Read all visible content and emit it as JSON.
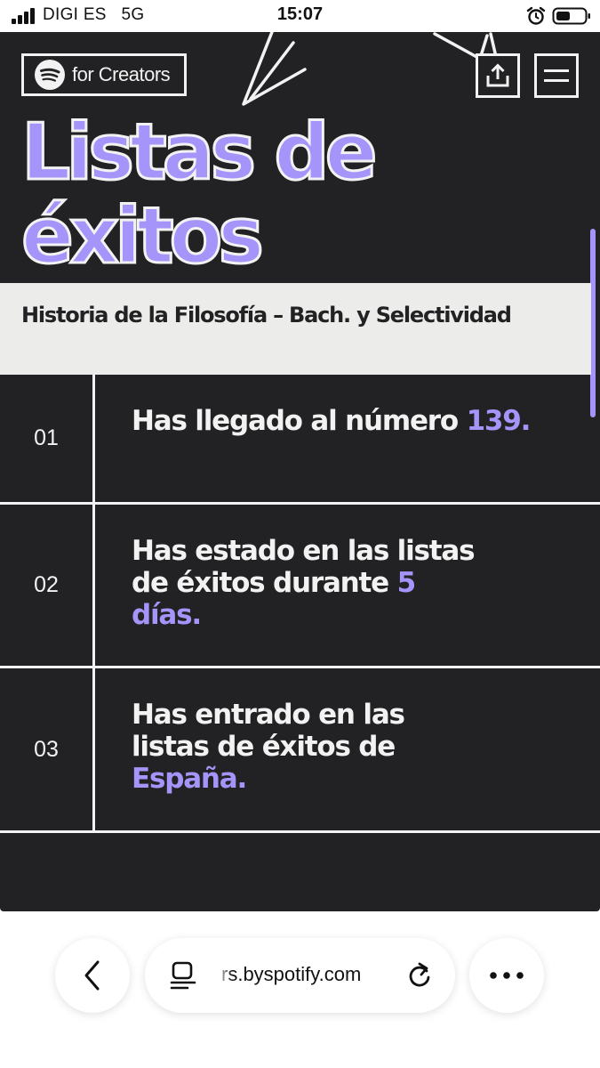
{
  "status_bar": {
    "carrier": "DIGI ES",
    "network": "5G",
    "time": "15:07"
  },
  "header": {
    "logo_text": "for Creators",
    "share_icon": "share-upload-icon",
    "menu_icon": "hamburger-menu-icon"
  },
  "hero": {
    "title": "Listas de éxitos"
  },
  "podcast": {
    "name": "Historia de la Filosofía – Bach. y Selectividad"
  },
  "stats": [
    {
      "number": "01",
      "text": "Has llegado al número ",
      "highlight": "139."
    },
    {
      "number": "02",
      "text": "Has estado en las listas de éxitos durante ",
      "highlight": "5 días."
    },
    {
      "number": "03",
      "text": "Has entrado en las listas de éxitos de ",
      "highlight": "España."
    }
  ],
  "browser": {
    "url": "rs.byspotify.com",
    "back_icon": "chevron-left-icon",
    "page_icon": "page-format-icon",
    "reload_icon": "reload-icon",
    "more_icon": "more-dots-icon"
  },
  "colors": {
    "background": "#222224",
    "accent": "#a594f9",
    "light": "#f2f2f2",
    "band": "#ececea"
  }
}
